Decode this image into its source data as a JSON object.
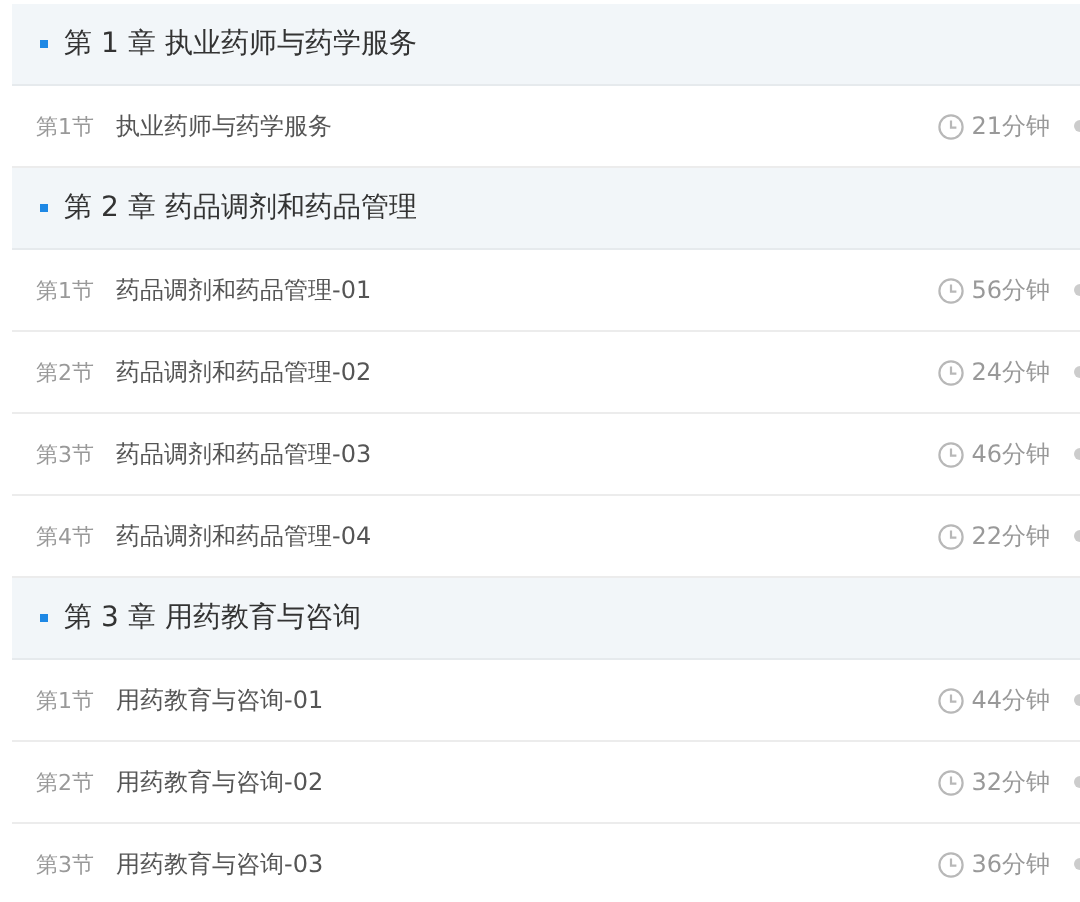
{
  "chapters": [
    {
      "title": "第 1 章 执业药师与药学服务",
      "sections": [
        {
          "number": "第1节",
          "title": "执业药师与药学服务",
          "duration": "21分钟"
        }
      ]
    },
    {
      "title": "第 2 章 药品调剂和药品管理",
      "sections": [
        {
          "number": "第1节",
          "title": "药品调剂和药品管理-01",
          "duration": "56分钟"
        },
        {
          "number": "第2节",
          "title": "药品调剂和药品管理-02",
          "duration": "24分钟"
        },
        {
          "number": "第3节",
          "title": "药品调剂和药品管理-03",
          "duration": "46分钟"
        },
        {
          "number": "第4节",
          "title": "药品调剂和药品管理-04",
          "duration": "22分钟"
        }
      ]
    },
    {
      "title": "第 3 章 用药教育与咨询",
      "sections": [
        {
          "number": "第1节",
          "title": "用药教育与咨询-01",
          "duration": "44分钟"
        },
        {
          "number": "第2节",
          "title": "用药教育与咨询-02",
          "duration": "32分钟"
        },
        {
          "number": "第3节",
          "title": "用药教育与咨询-03",
          "duration": "36分钟"
        }
      ]
    }
  ]
}
